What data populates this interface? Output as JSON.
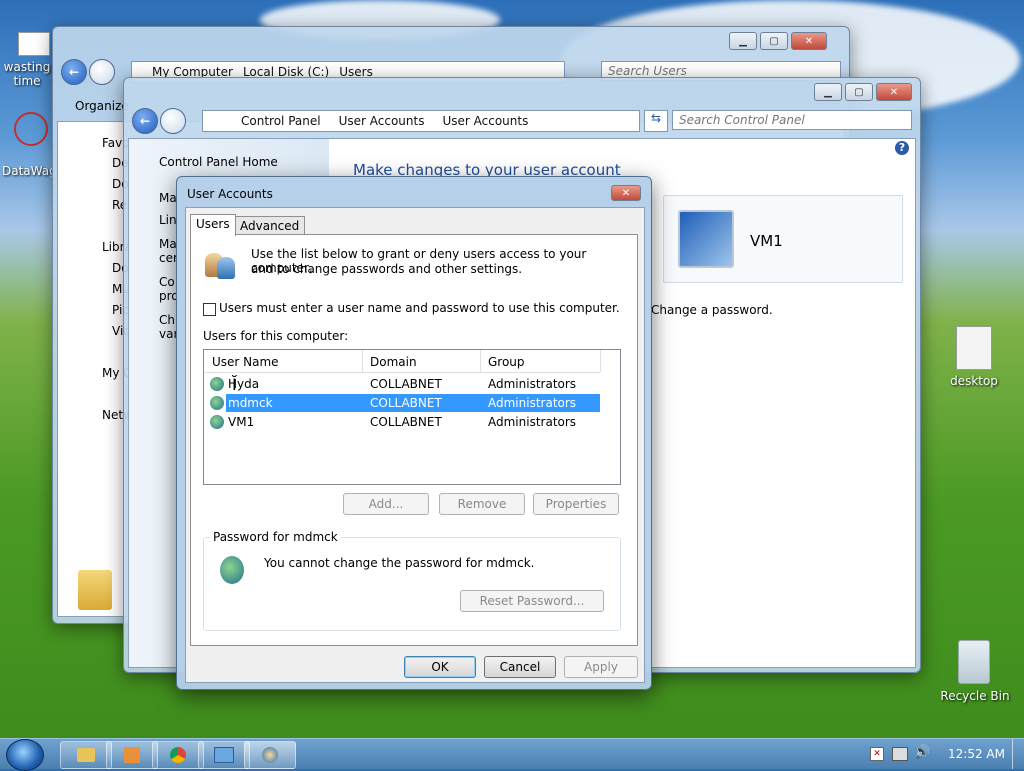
{
  "desktop": {
    "icons": [
      {
        "label": "wasting time"
      },
      {
        "label": "DataWag"
      },
      {
        "label": "desktop"
      },
      {
        "label": "Recycle Bin"
      }
    ]
  },
  "explorer": {
    "breadcrumb": [
      "My Computer",
      "Local Disk (C:)",
      "Users"
    ],
    "search_placeholder": "Search Users",
    "toolbar_organize": "Organize",
    "nav": [
      "Favo",
      "De",
      "Do",
      "Re",
      "Libra",
      "Do",
      "Mu",
      "Pic",
      "Vid",
      "My C",
      "Netw"
    ]
  },
  "controlpanel": {
    "breadcrumb": [
      "Control Panel",
      "User Accounts",
      "User Accounts"
    ],
    "search_placeholder": "Search Control Panel",
    "home_link": "Control Panel Home",
    "side_partial": [
      "Ma",
      "Lin",
      "Ma",
      "cer",
      "Co",
      "pro",
      "Ch",
      "var"
    ],
    "heading": "Make changes to your user account",
    "user_name": "VM1",
    "change_password_link": "Change a password."
  },
  "dialog": {
    "title": "User Accounts",
    "tabs": [
      "Users",
      "Advanced"
    ],
    "intro_line1": "Use the list below to grant or deny users access to your computer,",
    "intro_line2": "and to change passwords and other settings.",
    "checkbox_label": "Users must enter a user name and password to use this computer.",
    "users_label": "Users for this computer:",
    "columns": [
      "User Name",
      "Domain",
      "Group"
    ],
    "rows": [
      {
        "name": "Hyda",
        "domain": "COLLABNET",
        "group": "Administrators"
      },
      {
        "name": "mdmck",
        "domain": "COLLABNET",
        "group": "Administrators"
      },
      {
        "name": "VM1",
        "domain": "COLLABNET",
        "group": "Administrators"
      }
    ],
    "selected_row": 1,
    "btn_add": "Add...",
    "btn_remove": "Remove",
    "btn_properties": "Properties",
    "password_group_title": "Password for mdmck",
    "password_message": "You cannot change the password for mdmck.",
    "btn_reset": "Reset Password...",
    "btn_ok": "OK",
    "btn_cancel": "Cancel",
    "btn_apply": "Apply"
  },
  "taskbar": {
    "clock": "12:52 AM"
  },
  "colors": {
    "selection": "#3399ff",
    "link": "#1e4fa0"
  }
}
